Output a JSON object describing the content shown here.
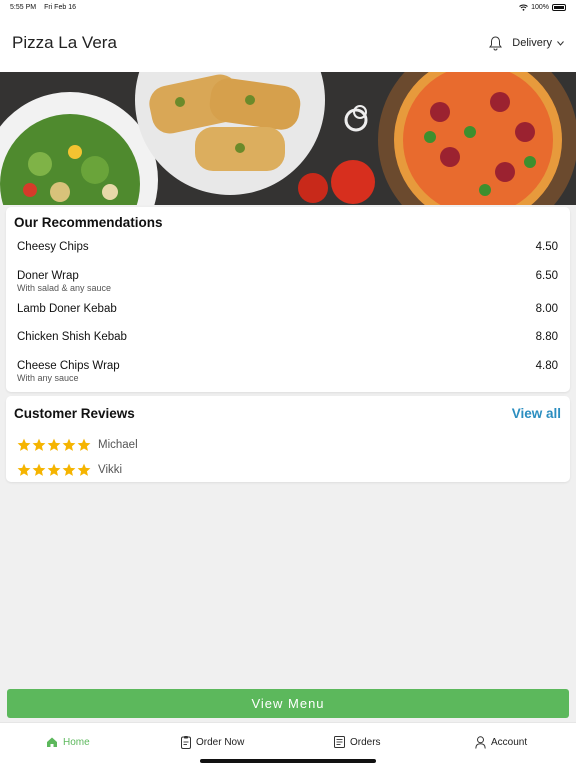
{
  "status_bar": {
    "time": "5:55 PM",
    "date": "Fri Feb 16",
    "battery": "100%"
  },
  "header": {
    "title": "Pizza La Vera",
    "delivery_label": "Delivery"
  },
  "recommendations": {
    "title": "Our Recommendations",
    "items": [
      {
        "name": "Cheesy Chips",
        "description": "",
        "price": "4.50"
      },
      {
        "name": "Doner Wrap",
        "description": "With salad & any sauce",
        "price": "6.50"
      },
      {
        "name": "Lamb Doner Kebab",
        "description": "",
        "price": "8.00"
      },
      {
        "name": "Chicken Shish Kebab",
        "description": "",
        "price": "8.80"
      },
      {
        "name": "Cheese Chips Wrap",
        "description": "With any sauce",
        "price": "4.80"
      }
    ]
  },
  "reviews": {
    "title": "Customer Reviews",
    "view_all_label": "View all",
    "items": [
      {
        "name": "Michael",
        "rating": 5
      },
      {
        "name": "Vikki",
        "rating": 5
      }
    ]
  },
  "view_menu_label": "View Menu",
  "tabs": [
    {
      "label": "Home",
      "icon": "home-icon",
      "active": true
    },
    {
      "label": "Order Now",
      "icon": "order-icon",
      "active": false
    },
    {
      "label": "Orders",
      "icon": "receipt-icon",
      "active": false
    },
    {
      "label": "Account",
      "icon": "user-icon",
      "active": false
    }
  ],
  "colors": {
    "accent_green": "#5cb85c",
    "link_blue": "#2b8ec0",
    "star_yellow": "#f5b400"
  }
}
